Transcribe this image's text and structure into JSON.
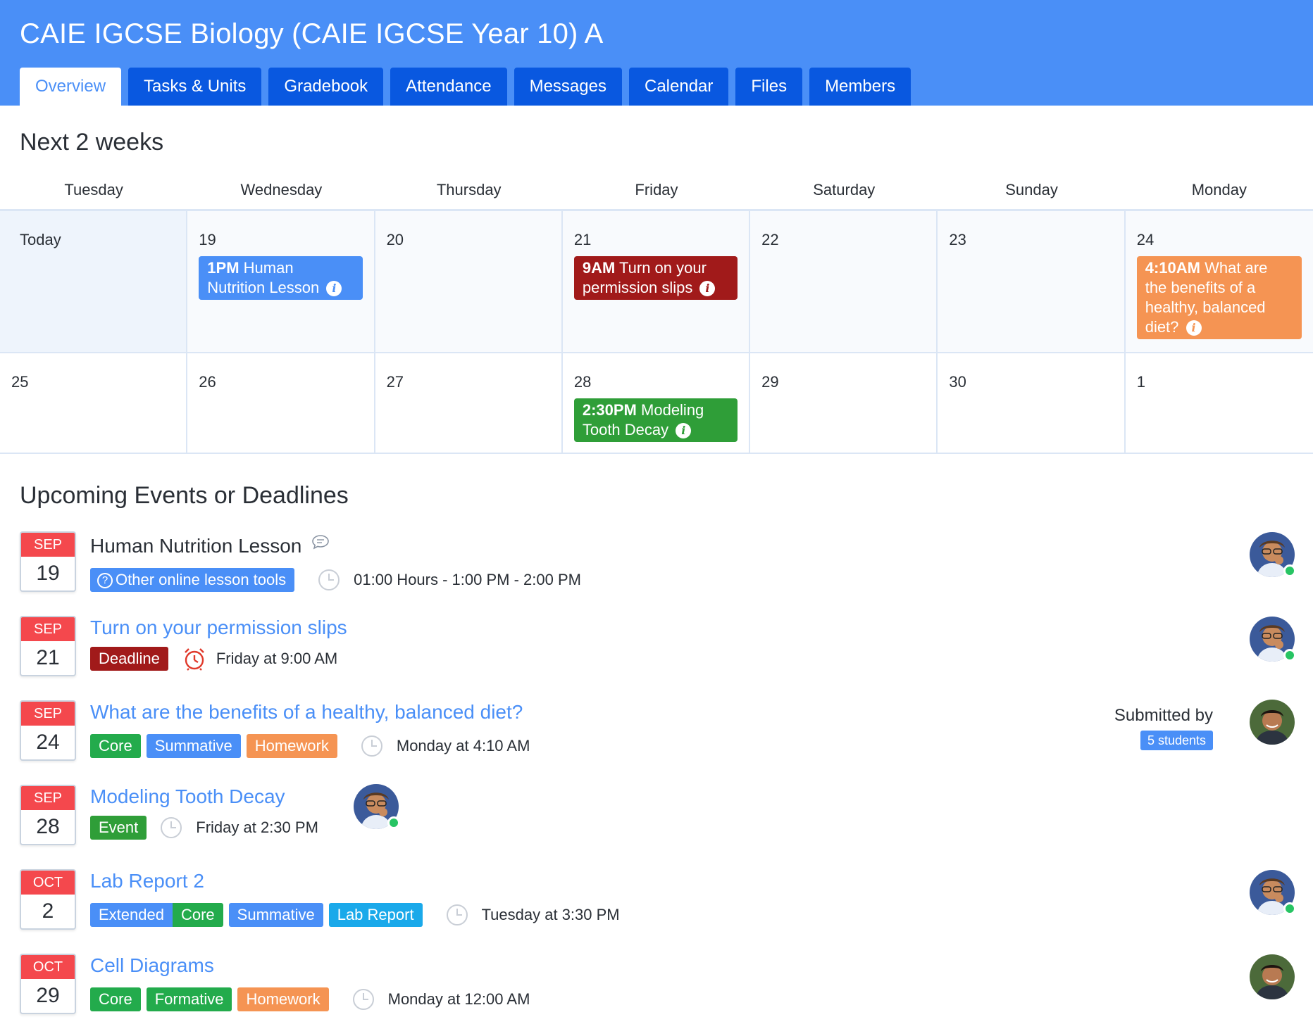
{
  "header": {
    "title": "CAIE IGCSE Biology (CAIE IGCSE Year 10) A",
    "tabs": [
      {
        "label": "Overview"
      },
      {
        "label": "Tasks & Units"
      },
      {
        "label": "Gradebook"
      },
      {
        "label": "Attendance"
      },
      {
        "label": "Messages"
      },
      {
        "label": "Calendar"
      },
      {
        "label": "Files"
      },
      {
        "label": "Members"
      }
    ],
    "active_tab": "Overview"
  },
  "calendar": {
    "title": "Next 2 weeks",
    "days": [
      "Tuesday",
      "Wednesday",
      "Thursday",
      "Friday",
      "Saturday",
      "Sunday",
      "Monday"
    ],
    "week1": {
      "today_label": "Today",
      "dates": [
        "19",
        "20",
        "21",
        "22",
        "23",
        "24"
      ],
      "events": {
        "e19": {
          "time": "1PM",
          "text": "Human Nutrition Lesson"
        },
        "e21": {
          "time": "9AM",
          "text": "Turn on your permission slips"
        },
        "e24": {
          "time": "4:10AM",
          "text": "What are the benefits of a healthy, balanced diet?"
        }
      }
    },
    "week2": {
      "dates": [
        "25",
        "26",
        "27",
        "28",
        "29",
        "30",
        "1"
      ],
      "events": {
        "e28": {
          "time": "2:30PM",
          "text": "Modeling Tooth Decay"
        }
      }
    },
    "info_glyph": "i"
  },
  "upcoming": {
    "title": "Upcoming Events or Deadlines",
    "items": [
      {
        "month": "SEP",
        "day": "19",
        "title": "Human Nutrition Lesson",
        "tag": "Other online lesson tools",
        "time": "01:00 Hours - 1:00 PM - 2:00 PM"
      },
      {
        "month": "SEP",
        "day": "21",
        "title": "Turn on your permission slips",
        "tag": "Deadline",
        "time": "Friday at 9:00 AM"
      },
      {
        "month": "SEP",
        "day": "24",
        "title": "What are the benefits of a healthy, balanced diet?",
        "tags": [
          "Core",
          "Summative",
          "Homework"
        ],
        "time": "Monday at 4:10 AM",
        "submitted_label": "Submitted by",
        "submitted_count": "5 students"
      },
      {
        "month": "SEP",
        "day": "28",
        "title": "Modeling Tooth Decay",
        "tag": "Event",
        "time": "Friday at 2:30 PM"
      },
      {
        "month": "OCT",
        "day": "2",
        "title": "Lab Report 2",
        "tags": [
          "Extended",
          "Core",
          "Summative",
          "Lab Report"
        ],
        "time": "Tuesday at 3:30 PM"
      },
      {
        "month": "OCT",
        "day": "29",
        "title": "Cell Diagrams",
        "tags": [
          "Core",
          "Formative",
          "Homework"
        ],
        "time": "Monday at 12:00 AM"
      }
    ]
  },
  "colors": {
    "header": "#4a8ff7",
    "tab": "#0958e0",
    "lesson": "#4a8ff7",
    "deadline": "#a11a1a",
    "homework": "#f59453",
    "event": "#2f9e38",
    "core": "#23ab4c",
    "online": "#27c463"
  }
}
